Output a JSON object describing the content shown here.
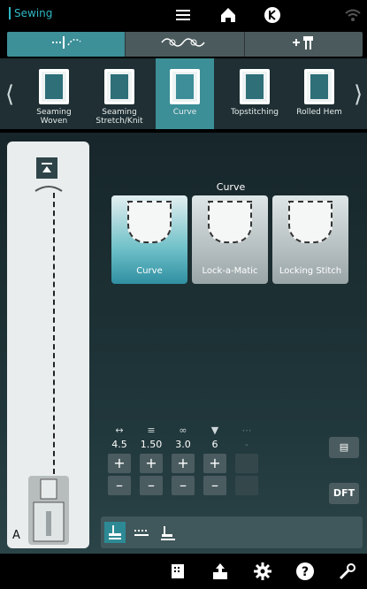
{
  "app": {
    "title": "Sewing"
  },
  "mode_tabs": [
    {
      "icon": "stitch-icon",
      "active": true
    },
    {
      "icon": "decorative-stitch-icon",
      "active": false
    },
    {
      "icon": "plus-foot-icon",
      "active": false
    }
  ],
  "techniques": [
    {
      "label": "Seaming Woven",
      "active": false
    },
    {
      "label": "Seaming Stretch/Knit",
      "active": false
    },
    {
      "label": "Curve",
      "active": true
    },
    {
      "label": "Topstitching",
      "active": false
    },
    {
      "label": "Rolled Hem",
      "active": false
    }
  ],
  "section": {
    "title": "Curve"
  },
  "options": [
    {
      "label": "Curve",
      "active": true
    },
    {
      "label": "Lock-a-Matic",
      "active": false
    },
    {
      "label": "Locking Stitch",
      "active": false
    }
  ],
  "params": [
    {
      "icon": "stitch-width-icon",
      "value": "4.5"
    },
    {
      "icon": "stitch-length-icon",
      "value": "1.50"
    },
    {
      "icon": "thread-tension-icon",
      "value": "3.0"
    },
    {
      "icon": "presser-foot-pressure-icon",
      "value": "6"
    },
    {
      "icon": "balance-icon",
      "value": "-"
    }
  ],
  "presser_foot": {
    "letter": "A"
  },
  "side_buttons": {
    "dft": "DFT"
  },
  "colors": {
    "accent": "#2fb8c4",
    "active": "#3c8e97"
  }
}
